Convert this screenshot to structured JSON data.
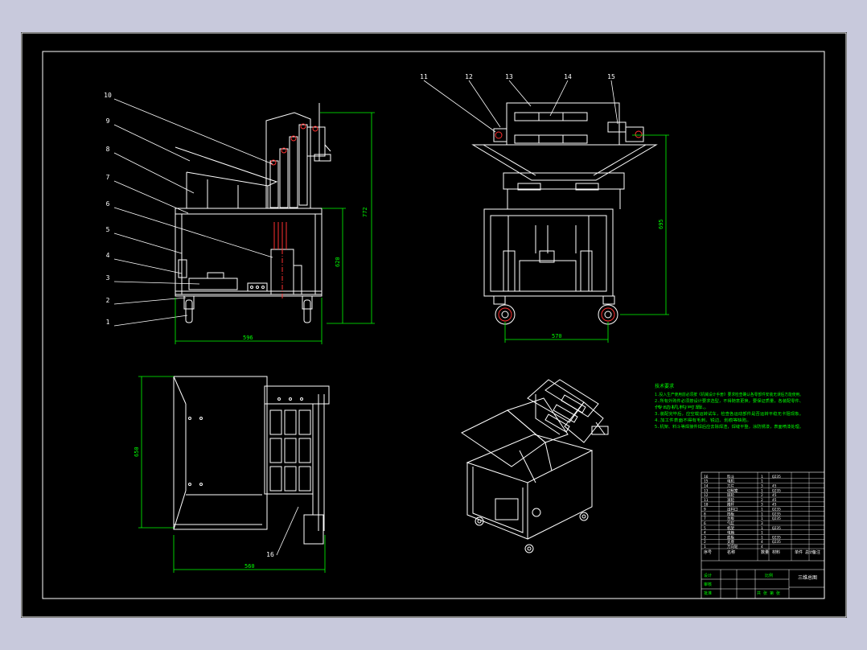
{
  "canvas": {
    "background": "#c8c9dc",
    "sheet_background": "#000000"
  },
  "colors": {
    "outline": "#ffffff",
    "dimension": "#00ff00",
    "callout": "#ffffff",
    "centerline": "#ff3030",
    "hidden": "#9090ff"
  },
  "views": {
    "side": {
      "labels": [
        "10",
        "9",
        "8",
        "7",
        "6",
        "5",
        "4",
        "3",
        "2",
        "1"
      ],
      "dims": {
        "height": "772",
        "inner_height": "620",
        "width": "596"
      }
    },
    "front": {
      "labels": [
        "11",
        "12",
        "13",
        "14",
        "15"
      ],
      "dims": {
        "height": "695",
        "width": "570"
      }
    },
    "top": {
      "labels": [
        "16"
      ],
      "dims": {
        "height": "650",
        "width": "560"
      }
    },
    "iso": {
      "labels": []
    }
  },
  "notes": {
    "title": "技术要求",
    "lines": [
      "1.投入生产使用前必须按《机械设计手册》要求检查确认各零部件安装无误后方能使用。",
      "2.所有外购件必须按设计要求选型，不得随意更换，要保证质量，各装配零件、",
      "   传动机构可靠。",
      "3.装配完毕后，应空载运转试车，检查各运动部件是否运转平稳无卡阻现象。",
      "4.加工件表面不得有毛刺、锐边、划痕等缺陷。",
      "5.机架、料斗等焊接件焊后应去除焊渣，焊缝平整，涂防锈漆，表面喷漆处理。"
    ]
  },
  "title_block": {
    "parts": [
      {
        "no": "16",
        "name": "料斗",
        "qty": "1",
        "mat": "Q235"
      },
      {
        "no": "15",
        "name": "电机",
        "qty": "1",
        "mat": ""
      },
      {
        "no": "14",
        "name": "刀片",
        "qty": "3",
        "mat": "45"
      },
      {
        "no": "13",
        "name": "切削室",
        "qty": "1",
        "mat": "Q235"
      },
      {
        "no": "12",
        "name": "链轮",
        "qty": "2",
        "mat": "45"
      },
      {
        "no": "11",
        "name": "滚轮",
        "qty": "2",
        "mat": "45"
      },
      {
        "no": "10",
        "name": "推杆",
        "qty": "3",
        "mat": "45"
      },
      {
        "no": "9",
        "name": "出料口",
        "qty": "1",
        "mat": "Q235"
      },
      {
        "no": "8",
        "name": "挡板",
        "qty": "1",
        "mat": "Q235"
      },
      {
        "no": "7",
        "name": "台板",
        "qty": "1",
        "mat": "Q235"
      },
      {
        "no": "6",
        "name": "气缸",
        "qty": "3",
        "mat": ""
      },
      {
        "no": "5",
        "name": "机架",
        "qty": "1",
        "mat": "Q235"
      },
      {
        "no": "4",
        "name": "电箱",
        "qty": "1",
        "mat": ""
      },
      {
        "no": "3",
        "name": "底板",
        "qty": "1",
        "mat": "Q235"
      },
      {
        "no": "2",
        "name": "支座",
        "qty": "4",
        "mat": "Q235"
      },
      {
        "no": "1",
        "name": "万向轮",
        "qty": "4",
        "mat": ""
      }
    ],
    "header": {
      "no": "序号",
      "name": "名称",
      "qty": "数量",
      "mat": "材料",
      "weight": "单件 总计",
      "remark": "备注"
    },
    "drawing_title": "三维总图",
    "scale": "比例",
    "sheet": "共 张 第 张",
    "design": "设计",
    "check": "审核",
    "approve": "批准"
  }
}
